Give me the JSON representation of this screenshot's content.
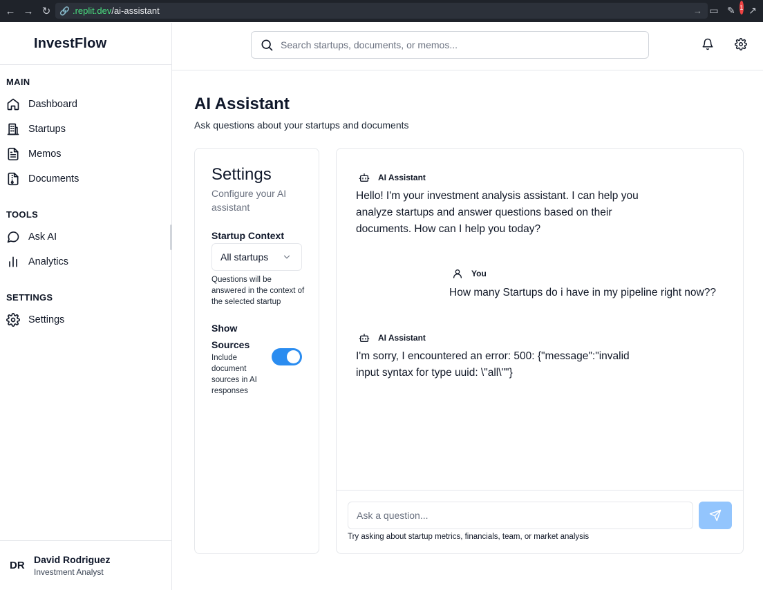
{
  "browser": {
    "url_prefix": ".replit.dev",
    "url_path": "/ai-assistant",
    "notification_count": "1"
  },
  "sidebar": {
    "brand": "InvestFlow",
    "sections": [
      {
        "title": "MAIN",
        "items": [
          {
            "label": "Dashboard",
            "icon": "home-icon"
          },
          {
            "label": "Startups",
            "icon": "building-icon"
          },
          {
            "label": "Memos",
            "icon": "file-text-icon"
          },
          {
            "label": "Documents",
            "icon": "file-archive-icon"
          }
        ]
      },
      {
        "title": "TOOLS",
        "items": [
          {
            "label": "Ask AI",
            "icon": "message-circle-icon"
          },
          {
            "label": "Analytics",
            "icon": "bar-chart-icon"
          }
        ]
      },
      {
        "title": "SETTINGS",
        "items": [
          {
            "label": "Settings",
            "icon": "gear-icon"
          }
        ]
      }
    ],
    "user": {
      "initials": "DR",
      "name": "David Rodriguez",
      "role": "Investment Analyst"
    }
  },
  "header": {
    "search_placeholder": "Search startups, documents, or memos..."
  },
  "page": {
    "title": "AI Assistant",
    "subtitle": "Ask questions about your startups and documents"
  },
  "settings": {
    "title": "Settings",
    "description": "Configure your AI assistant",
    "startup_context_label": "Startup Context",
    "startup_context_value": "All startups",
    "startup_context_help": "Questions will be answered in the context of the selected startup",
    "show_sources_label": "Show Sources",
    "show_sources_help": "Include document sources in AI responses",
    "show_sources_enabled": true
  },
  "chat": {
    "messages": [
      {
        "sender": "AI Assistant",
        "role": "assistant",
        "text": "Hello! I'm your investment analysis assistant. I can help you analyze startups and answer questions based on their documents. How can I help you today?"
      },
      {
        "sender": "You",
        "role": "user",
        "text": "How many Startups do i have in my pipeline right now??"
      },
      {
        "sender": "AI Assistant",
        "role": "assistant",
        "text": "I'm sorry, I encountered an error: 500: {\"message\":\"invalid input syntax for type uuid: \\\"all\\\"\"}"
      }
    ],
    "input_placeholder": "Ask a question...",
    "hint": "Try asking about startup metrics, financials, team, or market analysis"
  },
  "colors": {
    "accent": "#2a8cf0",
    "send_button": "#93c5fd",
    "border": "#e5e7eb"
  }
}
